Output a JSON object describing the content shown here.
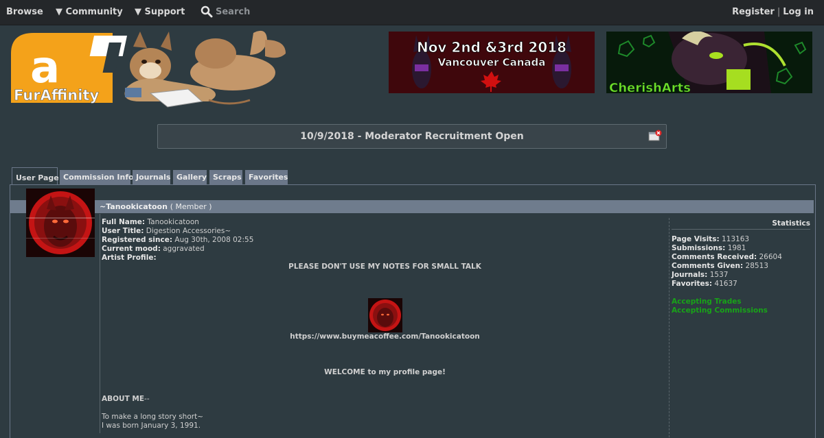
{
  "nav": {
    "browse": "Browse",
    "community": "▼ Community",
    "support": "▼ Support",
    "search": "Search",
    "register": "Register",
    "separator": "|",
    "login": "Log in"
  },
  "logo": {
    "text": "FurAffinity",
    "letter": "a"
  },
  "banners": [
    {
      "line1": "Nov 2nd &3rd 2018",
      "line2": "Vancouver Canada"
    },
    {
      "text": "CherishArts"
    }
  ],
  "notice": {
    "text": "10/9/2018 - Moderator Recruitment Open"
  },
  "tabs": [
    {
      "label": "User Page",
      "active": true
    },
    {
      "label": "Commission Info"
    },
    {
      "label": "Journals"
    },
    {
      "label": "Gallery"
    },
    {
      "label": "Scraps"
    },
    {
      "label": "Favorites"
    }
  ],
  "profile": {
    "username": "~Tanookicatoon",
    "role": "( Member )",
    "fields": [
      {
        "label": "Full Name:",
        "value": "Tanookicatoon"
      },
      {
        "label": "User Title:",
        "value": "Digestion Accessories~"
      },
      {
        "label": "Registered since:",
        "value": "Aug 30th, 2008 02:55"
      },
      {
        "label": "Current mood:",
        "value": "aggravated"
      },
      {
        "label": "Artist Profile:",
        "value": ""
      }
    ],
    "notes_warning": "PLEASE DON'T USE MY NOTES FOR SMALL TALK",
    "coffee_link": "https://www.buymeacoffee.com/Tanookicatoon",
    "welcome": "WELCOME to my profile page!",
    "about_heading": "ABOUT ME",
    "about_suffix": "--",
    "about_line1": "To make a long story short~",
    "about_line2": "I was born January 3, 1991."
  },
  "stats": {
    "title": "Statistics",
    "rows": [
      {
        "label": "Page Visits:",
        "value": "113163"
      },
      {
        "label": "Submissions:",
        "value": "1981"
      },
      {
        "label": "Comments Received:",
        "value": "26604"
      },
      {
        "label": "Comments Given:",
        "value": "28513"
      },
      {
        "label": "Journals:",
        "value": "1537"
      },
      {
        "label": "Favorites:",
        "value": "41637"
      }
    ],
    "accepting_trades": "Accepting Trades",
    "accepting_commissions": "Accepting Commissions"
  }
}
